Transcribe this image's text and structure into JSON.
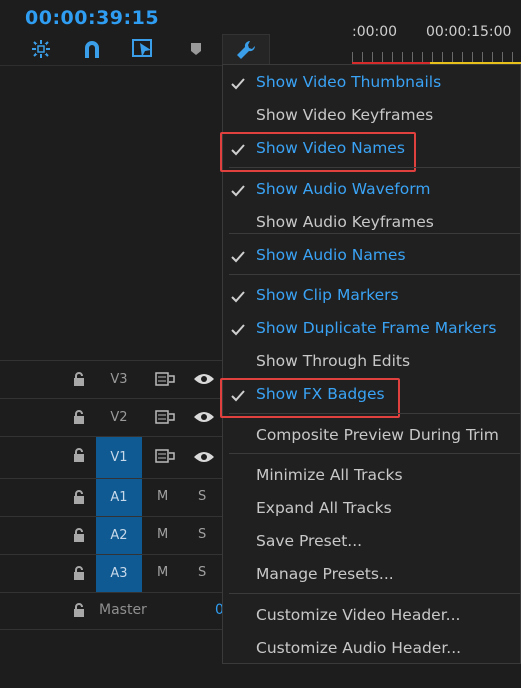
{
  "timecode": "00:00:39:15",
  "ruler": {
    "t0": ":00:00",
    "t1": "00:00:15:00"
  },
  "toolbar": {
    "icons": [
      "nest-sequence-icon",
      "snap-magnet-icon",
      "linked-selection-icon",
      "add-marker-icon",
      "wrench-icon"
    ]
  },
  "tracks": [
    {
      "name": "V3",
      "type": "video",
      "selected": false
    },
    {
      "name": "V2",
      "type": "video",
      "selected": false
    },
    {
      "name": "V1",
      "type": "video",
      "selected": true
    },
    {
      "name": "A1",
      "type": "audio",
      "selected": true,
      "m": "M",
      "s": "S"
    },
    {
      "name": "A2",
      "type": "audio",
      "selected": true,
      "m": "M",
      "s": "S"
    },
    {
      "name": "A3",
      "type": "audio",
      "selected": true,
      "m": "M",
      "s": "S"
    }
  ],
  "master": {
    "name": "Master",
    "value": "0"
  },
  "menu": {
    "items": [
      {
        "label": "Show Video Thumbnails",
        "checked": true
      },
      {
        "label": "Show Video Keyframes",
        "checked": false
      },
      {
        "label": "Show Video Names",
        "checked": true
      },
      {
        "label": "Show Audio Waveform",
        "checked": true
      },
      {
        "label": "Show Audio Keyframes",
        "checked": false
      },
      {
        "label": "Show Audio Names",
        "checked": true
      },
      {
        "label": "Show Clip Markers",
        "checked": true
      },
      {
        "label": "Show Duplicate Frame Markers",
        "checked": true
      },
      {
        "label": "Show Through Edits",
        "checked": false
      },
      {
        "label": "Show FX Badges",
        "checked": true
      },
      {
        "label": "Composite Preview During Trim",
        "checked": false
      },
      {
        "label": "Minimize All Tracks",
        "checked": false
      },
      {
        "label": "Expand All Tracks",
        "checked": false
      },
      {
        "label": "Save Preset...",
        "checked": false
      },
      {
        "label": "Manage Presets...",
        "checked": false
      },
      {
        "label": "Customize Video Header...",
        "checked": false
      },
      {
        "label": "Customize Audio Header...",
        "checked": false
      }
    ]
  },
  "colors": {
    "accent": "#3aa3f5",
    "highlight_box": "#e0403e",
    "selected_track": "#0f5a92"
  }
}
